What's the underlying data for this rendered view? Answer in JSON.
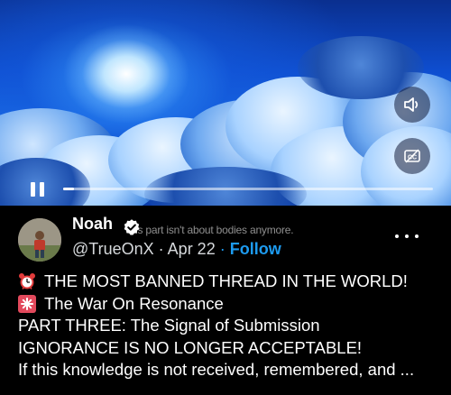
{
  "video": {
    "caption_overlay": "is part isn't about bodies anymore.",
    "progress": 0.03,
    "controls": {
      "pause": "pause-icon",
      "volume": "speaker-volume-icon",
      "captions": "closed-captions-icon"
    }
  },
  "author": {
    "name": "Noah",
    "handle": "@TrueOnX",
    "separator": "·",
    "date": "Apr 22",
    "separator2": "·",
    "follow_label": "Follow",
    "verified_icon": "verified-badge-icon"
  },
  "post": {
    "lines": [
      {
        "icon": "alarm-clock-emoji",
        "text": "THE MOST BANNED THREAD IN THE WORLD!"
      },
      {
        "icon": "eight-spoked-asterisk-emoji",
        "text": "The War On Resonance"
      },
      {
        "text": "PART THREE: The Signal of Submission"
      },
      {
        "text": "IGNORANCE IS NO LONGER ACCEPTABLE!"
      },
      {
        "text": "If this knowledge is not received, remembered, and ..."
      }
    ]
  },
  "colors": {
    "background": "#000000",
    "link": "#1d9bf0",
    "verified": "#1d9bf0"
  }
}
